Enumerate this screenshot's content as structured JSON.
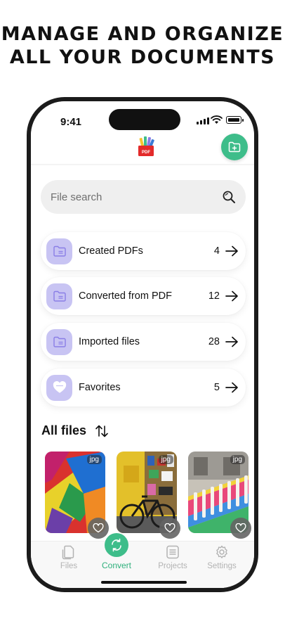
{
  "headline": {
    "line1": "MANAGE AND ORGANIZE",
    "line2": "ALL YOUR DOCUMENTS"
  },
  "status_bar": {
    "time": "9:41"
  },
  "app_bar": {
    "logo_text": "PDF",
    "logo_icon": "pdf-logo-icon",
    "add_button_icon": "folder-plus-icon"
  },
  "search": {
    "placeholder": "File search",
    "icon": "search-icon"
  },
  "folders": [
    {
      "label": "Created PDFs",
      "count": "4",
      "icon": "folder-icon"
    },
    {
      "label": "Converted from PDF",
      "count": "12",
      "icon": "folder-icon"
    },
    {
      "label": "Imported files",
      "count": "28",
      "icon": "folder-icon"
    },
    {
      "label": "Favorites",
      "count": "5",
      "icon": "heart-icon"
    }
  ],
  "all_files": {
    "title": "All files",
    "sort_icon": "sort-icon",
    "items": [
      {
        "type": "jpg"
      },
      {
        "type": "jpg"
      },
      {
        "type": "jpg"
      }
    ]
  },
  "bottom_nav": [
    {
      "label": "Files",
      "icon": "files-icon",
      "active": false
    },
    {
      "label": "Convert",
      "icon": "convert-icon",
      "active": true
    },
    {
      "label": "Projects",
      "icon": "projects-icon",
      "active": false
    },
    {
      "label": "Settings",
      "icon": "settings-icon",
      "active": false
    }
  ],
  "colors": {
    "accent": "#3ebd8a",
    "folder_icon_bg": "#c8c4f3",
    "folder_icon_fg": "#8a7ee6",
    "search_bg": "#efefef"
  }
}
